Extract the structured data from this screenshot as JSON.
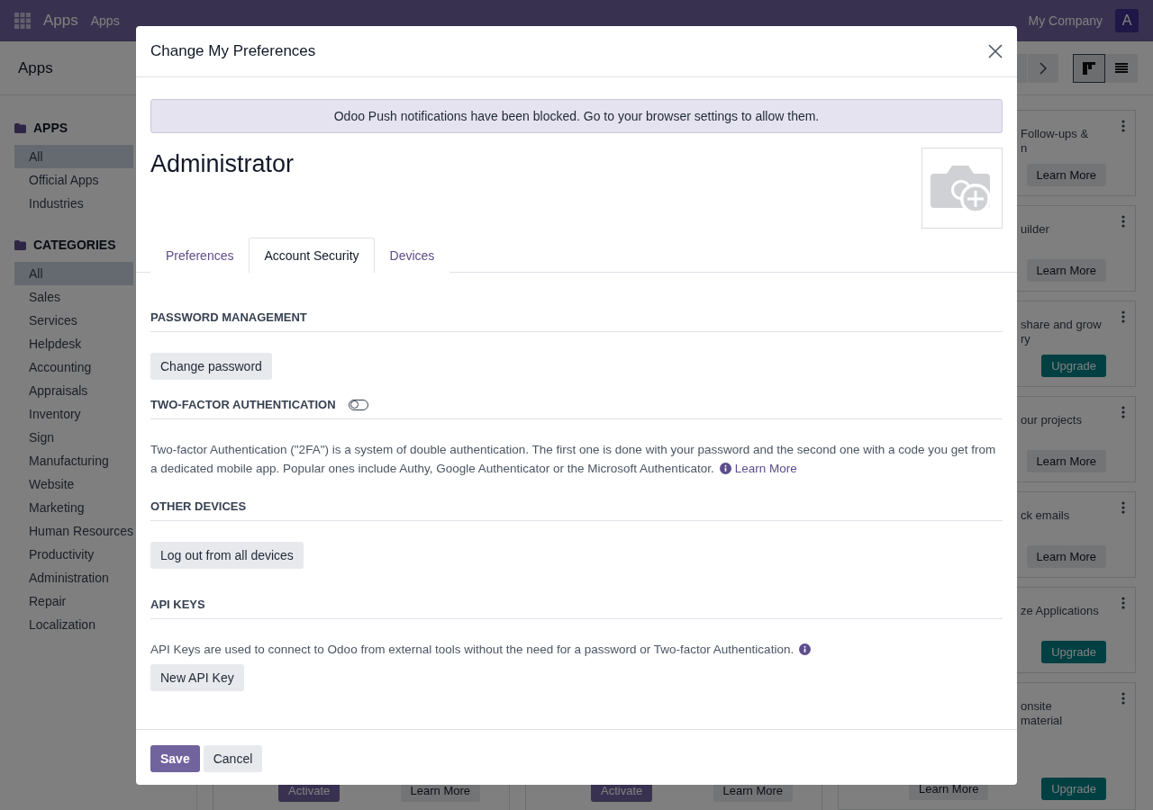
{
  "navbar": {
    "app_title": "Apps",
    "menu": [
      "Apps"
    ],
    "company": "My Company",
    "avatar_letter": "A"
  },
  "control_panel": {
    "breadcrumb": "Apps",
    "views": [
      {
        "kind": "kanban",
        "selected": true
      },
      {
        "kind": "list",
        "selected": false
      }
    ]
  },
  "sidebar": [
    {
      "title": "APPS",
      "items": [
        {
          "label": "All",
          "selected": true
        },
        {
          "label": "Official Apps",
          "selected": false
        },
        {
          "label": "Industries",
          "selected": false
        }
      ]
    },
    {
      "title": "CATEGORIES",
      "items": [
        {
          "label": "All",
          "selected": true
        },
        {
          "label": "Sales",
          "selected": false
        },
        {
          "label": "Services",
          "selected": false
        },
        {
          "label": "Helpdesk",
          "selected": false
        },
        {
          "label": "Accounting",
          "selected": false
        },
        {
          "label": "Appraisals",
          "selected": false
        },
        {
          "label": "Inventory",
          "selected": false
        },
        {
          "label": "Sign",
          "selected": false
        },
        {
          "label": "Manufacturing",
          "selected": false
        },
        {
          "label": "Website",
          "selected": false
        },
        {
          "label": "Marketing",
          "selected": false
        },
        {
          "label": "Human Resources",
          "selected": false
        },
        {
          "label": "Productivity",
          "selected": false
        },
        {
          "label": "Administration",
          "selected": false
        },
        {
          "label": "Repair",
          "selected": false
        },
        {
          "label": "Localization",
          "selected": false
        }
      ]
    }
  ],
  "bottom_cards": [
    {
      "buttons": [
        {
          "kind": "activate",
          "label": "Activate"
        },
        {
          "kind": "learn",
          "label": "Learn More"
        }
      ]
    },
    {
      "buttons": [
        {
          "kind": "activate",
          "label": "Activate"
        },
        {
          "kind": "learn",
          "label": "Learn More"
        }
      ]
    }
  ],
  "right_cards": [
    {
      "lines": [
        "Follow-ups &",
        "n"
      ],
      "buttons": [
        {
          "kind": "learn",
          "label": "Learn More"
        }
      ]
    },
    {
      "lines": [
        "uilder"
      ],
      "buttons": [
        {
          "kind": "learn",
          "label": "Learn More"
        }
      ]
    },
    {
      "lines": [
        "share and grow",
        "ry"
      ],
      "buttons": [
        {
          "kind": "upgrade",
          "label": "Upgrade"
        }
      ]
    },
    {
      "lines": [
        "our projects"
      ],
      "buttons": [
        {
          "kind": "learn",
          "label": "Learn More"
        }
      ]
    },
    {
      "lines": [
        "ck emails"
      ],
      "buttons": [
        {
          "kind": "learn",
          "label": "Learn More"
        }
      ]
    },
    {
      "lines": [
        "ze Applications"
      ],
      "buttons": [
        {
          "kind": "upgrade",
          "label": "Upgrade"
        }
      ]
    },
    {
      "lines": [
        "onsite",
        "material"
      ],
      "buttons": [
        {
          "kind": "learn",
          "label": "Learn More"
        },
        {
          "kind": "upgrade",
          "label": "Upgrade"
        }
      ]
    }
  ],
  "dialog": {
    "title": "Change My Preferences",
    "alert": "Odoo Push notifications have been blocked. Go to your browser settings to allow them.",
    "name": "Administrator",
    "tabs": [
      {
        "label": "Preferences",
        "selected": false
      },
      {
        "label": "Account Security",
        "selected": true
      },
      {
        "label": "Devices",
        "selected": false
      }
    ],
    "sections": [
      {
        "heading": "PASSWORD MANAGEMENT",
        "buttons": [
          "Change password"
        ]
      },
      {
        "heading": "TWO-FACTOR AUTHENTICATION",
        "toggle": {
          "on": false
        },
        "text": "Two-factor Authentication (\"2FA\") is a system of double authentication. The first one is done with your password and the second one with a code you get from a dedicated mobile app. Popular ones include Authy, Google Authenticator or the Microsoft Authenticator.",
        "link": "Learn More"
      },
      {
        "heading": "OTHER DEVICES",
        "buttons": [
          "Log out from all devices"
        ]
      },
      {
        "heading": "API KEYS",
        "text": "API Keys are used to connect to Odoo from external tools without the need for a password or Two-factor Authentication.",
        "info": true,
        "buttons": [
          "New API Key"
        ]
      }
    ],
    "footer_buttons": [
      {
        "kind": "primary",
        "label": "Save"
      },
      {
        "kind": "secondary",
        "label": "Cancel"
      }
    ]
  }
}
